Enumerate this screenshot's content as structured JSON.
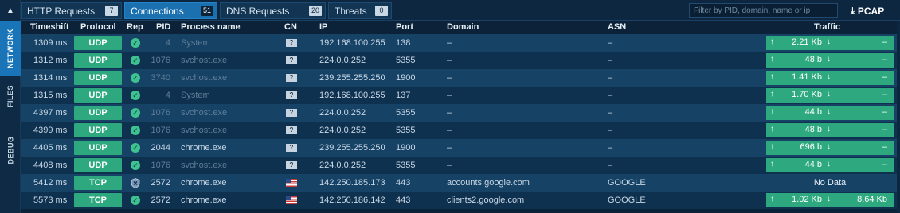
{
  "rail": {
    "collapse_icon": "▲",
    "tabs": [
      {
        "label": "NETWORK",
        "active": true
      },
      {
        "label": "FILES",
        "active": false
      },
      {
        "label": "DEBUG",
        "active": false
      }
    ]
  },
  "tabs": [
    {
      "label": "HTTP Requests",
      "count": "7",
      "active": false
    },
    {
      "label": "Connections",
      "count": "51",
      "active": true
    },
    {
      "label": "DNS Requests",
      "count": "20",
      "active": false
    },
    {
      "label": "Threats",
      "count": "0",
      "active": false
    }
  ],
  "filter": {
    "placeholder": "Filter by PID, domain, name or ip",
    "value": ""
  },
  "pcap": {
    "label": "PCAP",
    "icon": "download-icon"
  },
  "columns": {
    "timeshift": "Timeshift",
    "protocol": "Protocol",
    "rep": "Rep",
    "pid": "PID",
    "process": "Process name",
    "cn": "CN",
    "ip": "IP",
    "port": "Port",
    "domain": "Domain",
    "asn": "ASN",
    "traffic": "Traffic"
  },
  "colors": {
    "accent": "#1b70b0",
    "protocol_bg": "#2ea97f",
    "background": "#0b2238"
  },
  "rows": [
    {
      "timeshift": "1309 ms",
      "protocol": "UDP",
      "rep": "ok",
      "pid": "4",
      "process": "System",
      "dim": true,
      "cn": "?",
      "ip": "192.168.100.255",
      "port": "138",
      "domain": "–",
      "asn": "–",
      "sent": "2.21 Kb",
      "recv": "–"
    },
    {
      "timeshift": "1312 ms",
      "protocol": "UDP",
      "rep": "ok",
      "pid": "1076",
      "process": "svchost.exe",
      "dim": true,
      "cn": "?",
      "ip": "224.0.0.252",
      "port": "5355",
      "domain": "–",
      "asn": "–",
      "sent": "48 b",
      "recv": "–"
    },
    {
      "timeshift": "1314 ms",
      "protocol": "UDP",
      "rep": "ok",
      "pid": "3740",
      "process": "svchost.exe",
      "dim": true,
      "cn": "?",
      "ip": "239.255.255.250",
      "port": "1900",
      "domain": "–",
      "asn": "–",
      "sent": "1.41 Kb",
      "recv": "–"
    },
    {
      "timeshift": "1315 ms",
      "protocol": "UDP",
      "rep": "ok",
      "pid": "4",
      "process": "System",
      "dim": true,
      "cn": "?",
      "ip": "192.168.100.255",
      "port": "137",
      "domain": "–",
      "asn": "–",
      "sent": "1.70 Kb",
      "recv": "–"
    },
    {
      "timeshift": "4397 ms",
      "protocol": "UDP",
      "rep": "ok",
      "pid": "1076",
      "process": "svchost.exe",
      "dim": true,
      "cn": "?",
      "ip": "224.0.0.252",
      "port": "5355",
      "domain": "–",
      "asn": "–",
      "sent": "44 b",
      "recv": "–"
    },
    {
      "timeshift": "4399 ms",
      "protocol": "UDP",
      "rep": "ok",
      "pid": "1076",
      "process": "svchost.exe",
      "dim": true,
      "cn": "?",
      "ip": "224.0.0.252",
      "port": "5355",
      "domain": "–",
      "asn": "–",
      "sent": "48 b",
      "recv": "–"
    },
    {
      "timeshift": "4405 ms",
      "protocol": "UDP",
      "rep": "ok",
      "pid": "2044",
      "process": "chrome.exe",
      "dim": false,
      "cn": "?",
      "ip": "239.255.255.250",
      "port": "1900",
      "domain": "–",
      "asn": "–",
      "sent": "696 b",
      "recv": "–"
    },
    {
      "timeshift": "4408 ms",
      "protocol": "UDP",
      "rep": "ok",
      "pid": "1076",
      "process": "svchost.exe",
      "dim": true,
      "cn": "?",
      "ip": "224.0.0.252",
      "port": "5355",
      "domain": "–",
      "asn": "–",
      "sent": "44 b",
      "recv": "–"
    },
    {
      "timeshift": "5412 ms",
      "protocol": "TCP",
      "rep": "shield",
      "pid": "2572",
      "process": "chrome.exe",
      "dim": false,
      "cn": "us-flag",
      "ip": "142.250.185.173",
      "port": "443",
      "domain": "accounts.google.com",
      "asn": "GOOGLE",
      "nodata": "No Data"
    },
    {
      "timeshift": "5573 ms",
      "protocol": "TCP",
      "rep": "ok",
      "pid": "2572",
      "process": "chrome.exe",
      "dim": false,
      "cn": "us-flag",
      "ip": "142.250.186.142",
      "port": "443",
      "domain": "clients2.google.com",
      "asn": "GOOGLE",
      "sent": "1.02 Kb",
      "recv": "8.64 Kb"
    }
  ]
}
